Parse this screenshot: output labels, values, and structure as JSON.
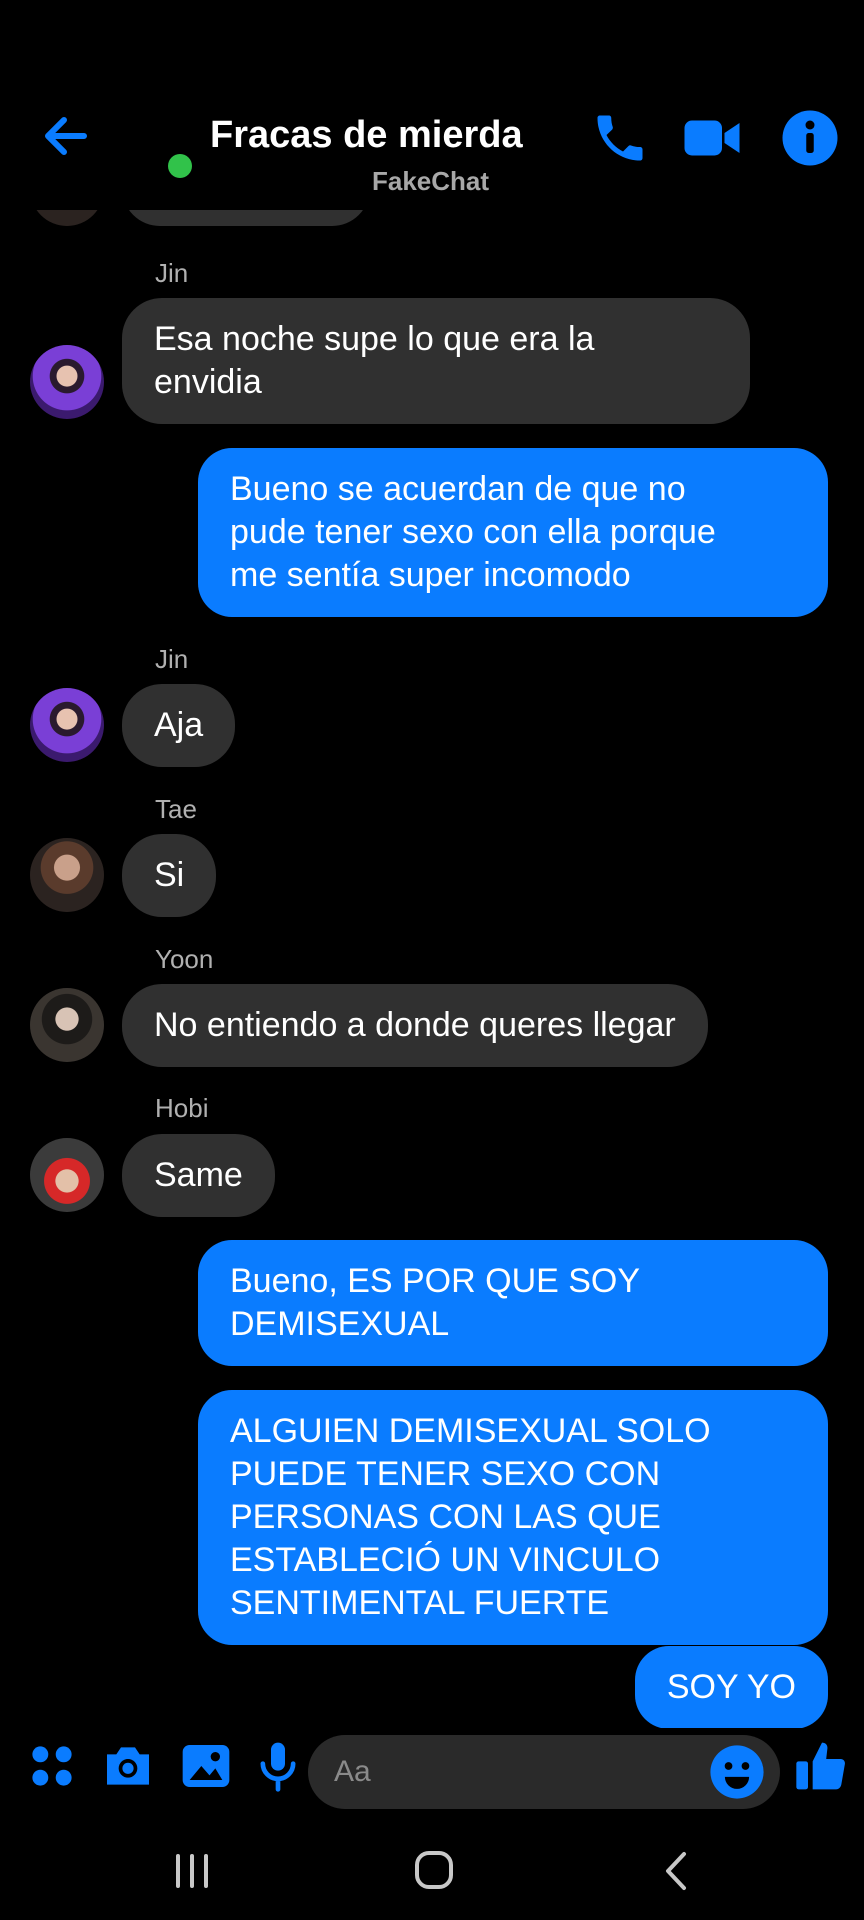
{
  "header": {
    "title": "Fracas de mierda",
    "subtitle": "FakeChat",
    "online_color": "#31c24a",
    "icons": [
      "back-arrow-icon",
      "phone-icon",
      "video-camera-icon",
      "info-icon"
    ]
  },
  "messages": [
    {
      "type": "in",
      "sender": "Jin",
      "text": "Esa noche supe lo que era la envidia",
      "lines": [
        "Esa noche supe lo que era la",
        "envidia"
      ]
    },
    {
      "type": "out",
      "text": "Bueno se acuerdan de que no pude tener sexo con ella porque me sentía super incomodo",
      "lines": [
        "Bueno se acuerdan de que no",
        "pude tener sexo con ella porque",
        "me sentía super incomodo"
      ]
    },
    {
      "type": "in",
      "sender": "Jin",
      "text": "Aja"
    },
    {
      "type": "in",
      "sender": "Tae",
      "text": "Si"
    },
    {
      "type": "in",
      "sender": "Yoon",
      "text": "No entiendo a donde queres llegar"
    },
    {
      "type": "in",
      "sender": "Hobi",
      "text": "Same"
    },
    {
      "type": "out",
      "text": "Bueno, ES POR QUE SOY DEMISEXUAL",
      "lines": [
        "Bueno, ES POR QUE SOY",
        "DEMISEXUAL"
      ]
    },
    {
      "type": "out",
      "text": "ALGUIEN DEMISEXUAL SOLO PUEDE TENER SEXO CON PERSONAS CON LAS QUE ESTABLECIÓ UN VINCULO SENTIMENTAL FUERTE",
      "lines": [
        "ALGUIEN DEMISEXUAL SOLO",
        "PUEDE TENER SEXO CON",
        "PERSONAS CON LAS QUE",
        "ESTABLECIÓ UN VINCULO",
        "SENTIMENTAL FUERTE"
      ]
    },
    {
      "type": "out",
      "text": "SOY YO"
    }
  ],
  "composer": {
    "placeholder": "Aa",
    "icons": [
      "apps-grid-icon",
      "camera-icon",
      "gallery-icon",
      "microphone-icon",
      "emoji-icon",
      "thumbs-up-icon"
    ]
  },
  "navbar": {
    "icons": [
      "recent-apps-icon",
      "home-icon",
      "nav-back-icon"
    ]
  },
  "colors": {
    "accent": "#0a7cff",
    "incoming_bubble": "#303030",
    "background": "#000000"
  }
}
